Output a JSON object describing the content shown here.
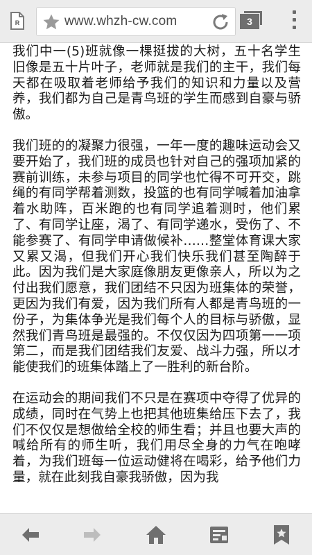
{
  "browser": {
    "url": "www.whzh-cw.com",
    "tab_count": "3",
    "icons": {
      "tab": "page-r-icon",
      "bookmark": "star-icon",
      "reload": "reload-icon",
      "tabs": "tabs-icon",
      "menu": "overflow-menu-icon"
    }
  },
  "article": {
    "paragraphs": [
      "我们中一(5)班就像一棵挺拔的大树，五十名学生旧像是五十片叶子，老师就是我们的主干，我们每天都在吸取着老师给予我们的知识和力量以及营养，我们都为自己是青鸟班的学生而感到自豪与骄傲。",
      "我们班的的凝聚力很强，一年一度的趣味运动会又要开始了，我们班的成员也针对自己的强项加紧的赛前训练，未参与项目的同学也忙得不可开交，跳绳的有同学帮着测数，投篮的也有同学喊着加油拿着水助阵，百米跑的也有同学追着测时，他们累了、有同学让座，渴了、有同学递水，受伤了、不能参赛了、有同学申请做候补……整堂体育课大家又累又渴，但我们开心我们快乐我们甚至陶醉于此。因为我们是大家庭像朋友更像亲人，所以为之付出我们愿意，我们团结不只因为班集体的荣誉，更因为我们有爱，因为我们所有人都是青鸟班的一份子，为集体争光是我们每个人的目标与骄傲，显然我们青鸟班是最强的。不仅仅因为四项第一一项第二，而是我们团结我们友爱、战斗力强，所以才能使我们的班集体踏上了一胜利的新台阶。",
      "在运动会的期间我们不只是在赛项中夺得了优异的成绩，同时在气势上也把其他班集给压下去了，我们不仅仅是想做给全校的师生看；并且也要大声的喊给所有的师生听，我们用尽全身的力气在咆哮着，为我们班每一位运动健将在喝彩，给予他们力量，就在此刻我自豪我骄傲，因为我"
    ]
  },
  "bottom_nav": {
    "icons": [
      "back-arrow-icon",
      "forward-arrow-icon",
      "home-icon",
      "reading-list-icon",
      "bookmark-icon"
    ]
  },
  "colors": {
    "bar_background": "#ececec",
    "icon_gray": "#6f6f6f",
    "disabled_icon": "#bdbdbd",
    "text": "#1c1c1c"
  }
}
